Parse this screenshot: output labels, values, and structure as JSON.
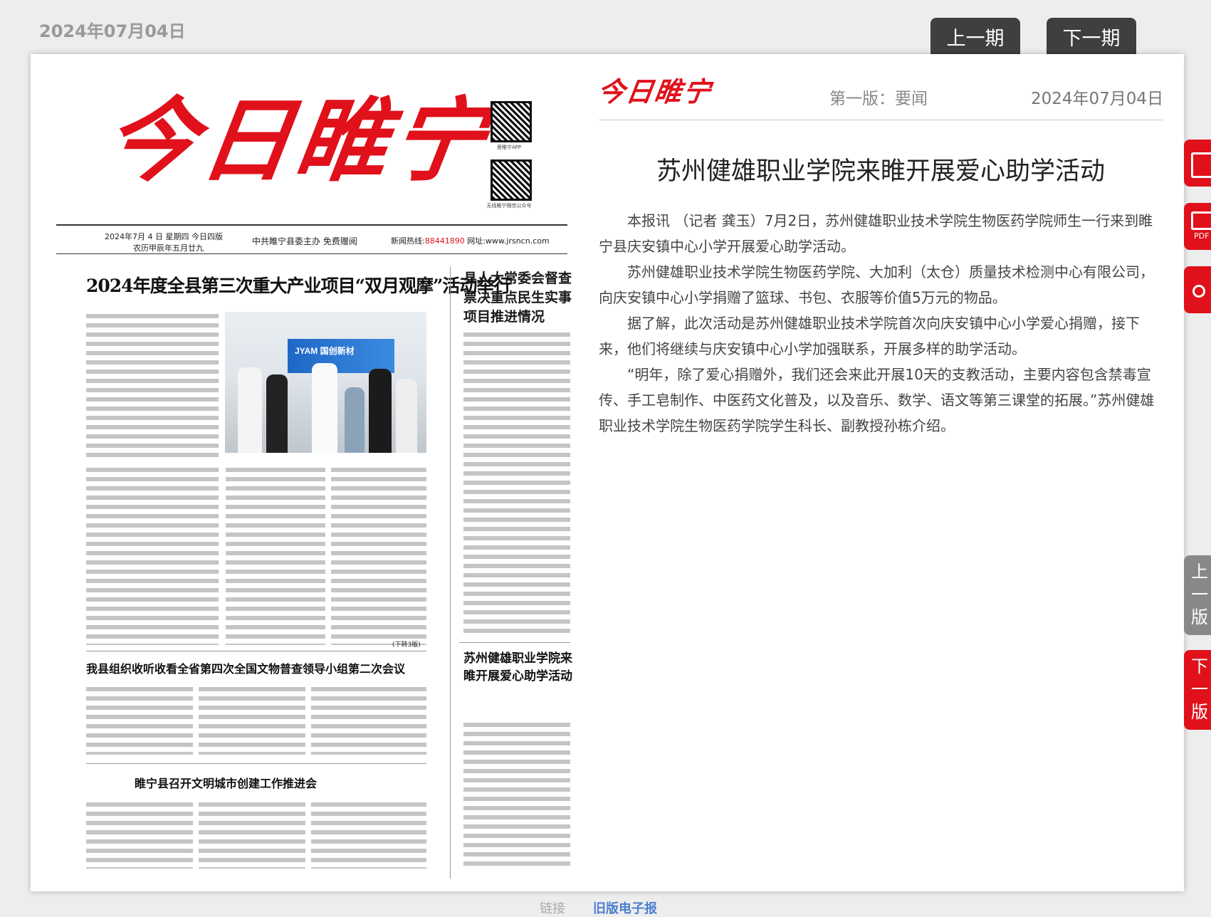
{
  "top": {
    "date": "2024年07月04日",
    "prev_label": "上一期",
    "next_label": "下一期"
  },
  "paper": {
    "masthead": "今日睢宁",
    "qr_caption_1": "爱睢宁APP",
    "qr_caption_2": "无线睢宁微信公众号",
    "dateline_1": "2024年7月 4 日   星期四  今日四版",
    "dateline_2": "农历甲辰年五月廿九",
    "sponsor": "中共睢宁县委主办  免费赠阅",
    "hotline_label": "新闻热线:",
    "hotline_number": "88441890",
    "website": "网址:www.jrsncn.com",
    "headline_main": "2024年度全县第三次重大产业项目“双月观摩”活动举行",
    "headline_right": "县人大常委会督查票决重点民生实事项目推进情况",
    "headline_art2": "我县组织收听收看全省第四次全国文物普查领导小组第二次会议",
    "headline_art3": "睢宁县召开文明城市创建工作推进会",
    "headline_art4": "苏州健雄职业学院来睢开展爱心助学活动",
    "photo_sign": "JYAM 国创新材",
    "continued": "(下转3版)"
  },
  "article": {
    "logo": "今日睢宁",
    "edition": "第一版：要闻",
    "date": "2024年07月04日",
    "title": "苏州健雄职业学院来睢开展爱心助学活动",
    "paragraphs": [
      "本报讯 （记者 龚玉）7月2日，苏州健雄职业技术学院生物医药学院师生一行来到睢宁县庆安镇中心小学开展爱心助学活动。",
      "苏州健雄职业技术学院生物医药学院、大加利（太仓）质量技术检测中心有限公司，向庆安镇中心小学捐赠了篮球、书包、衣服等价值5万元的物品。",
      "据了解，此次活动是苏州健雄职业技术学院首次向庆安镇中心小学爱心捐赠，接下来，他们将继续与庆安镇中心小学加强联系，开展多样的助学活动。",
      "“明年，除了爱心捐赠外，我们还会来此开展10天的支教活动，主要内容包含禁毒宣传、手工皂制作、中医药文化普及，以及音乐、数学、语文等第三课堂的拓展。”苏州健雄职业技术学院生物医药学院学生科长、副教授孙栋介绍。"
    ]
  },
  "side": {
    "pdf_label": "PDF",
    "prev_page": [
      "上",
      "一",
      "版"
    ],
    "next_page": [
      "下",
      "一",
      "版"
    ]
  },
  "footer": {
    "link1": "链接",
    "link2": "旧版电子报"
  },
  "colors": {
    "brand_red": "#e0111b",
    "nav_dark": "#3f3f3f"
  }
}
